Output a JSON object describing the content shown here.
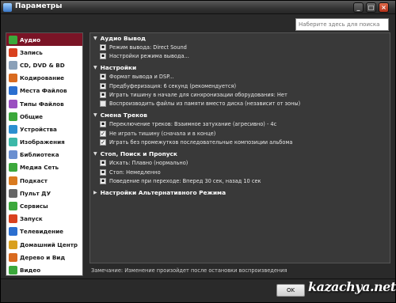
{
  "window": {
    "title": "Параметры"
  },
  "search": {
    "placeholder": "Наберите здесь для поиска"
  },
  "sidebar": {
    "items": [
      {
        "label": "Аудио",
        "icon": "speaker-icon",
        "color": "#3ba83b",
        "active": true
      },
      {
        "label": "Запись",
        "icon": "record-icon",
        "color": "#d9411f"
      },
      {
        "label": "CD, DVD & BD",
        "icon": "disc-icon",
        "color": "#8aa0b8"
      },
      {
        "label": "Кодирование",
        "icon": "encode-icon",
        "color": "#d96a1f"
      },
      {
        "label": "Места Файлов",
        "icon": "folder-icon",
        "color": "#2b6fd0"
      },
      {
        "label": "Типы Файлов",
        "icon": "filetype-icon",
        "color": "#9a4fc0"
      },
      {
        "label": "Общие",
        "icon": "general-icon",
        "color": "#3ba83b"
      },
      {
        "label": "Устройства",
        "icon": "device-icon",
        "color": "#2b8fd0"
      },
      {
        "label": "Изображения",
        "icon": "image-icon",
        "color": "#3bb8a8"
      },
      {
        "label": "Библиотека",
        "icon": "library-icon",
        "color": "#6a8fd0"
      },
      {
        "label": "Медиа Сеть",
        "icon": "network-icon",
        "color": "#3ba83b"
      },
      {
        "label": "Подкаст",
        "icon": "podcast-icon",
        "color": "#d97a1f"
      },
      {
        "label": "Пульт ДУ",
        "icon": "remote-icon",
        "color": "#666666"
      },
      {
        "label": "Сервисы",
        "icon": "services-icon",
        "color": "#3ba83b"
      },
      {
        "label": "Запуск",
        "icon": "startup-icon",
        "color": "#d9411f"
      },
      {
        "label": "Телевидение",
        "icon": "tv-icon",
        "color": "#2b6fd0"
      },
      {
        "label": "Домашний Центр",
        "icon": "home-icon",
        "color": "#d9a01f"
      },
      {
        "label": "Дерево и Вид",
        "icon": "tree-icon",
        "color": "#d96a1f"
      },
      {
        "label": "Видео",
        "icon": "video-icon",
        "color": "#3ba83b"
      }
    ]
  },
  "sections": {
    "audio_output": {
      "title": "Аудио Вывод",
      "rows": [
        {
          "label": "Режим вывода: Direct Sound",
          "type": "link"
        },
        {
          "label": "Настройки режима вывода...",
          "type": "link"
        }
      ]
    },
    "settings": {
      "title": "Настройки",
      "rows": [
        {
          "label": "Формат вывода и DSP...",
          "type": "link"
        },
        {
          "label": "Предбуферизация: 6 секунд (рекомендуется)",
          "type": "link"
        },
        {
          "label": "Играть тишину в начале для синхронизации оборудования: Нет",
          "type": "link"
        },
        {
          "label": "Воспроизводить файлы из памяти вместо диска (независит от зоны)",
          "type": "checkbox",
          "checked": false
        }
      ]
    },
    "track_change": {
      "title": "Смена Треков",
      "rows": [
        {
          "label": "Переключение треков: Взаимное затухание (агресивно) - 4с",
          "type": "link"
        },
        {
          "label": "Не играть тишину (сначала и в конце)",
          "type": "checkbox",
          "checked": true
        },
        {
          "label": "Играть без промежутков последовательные композиции альбома",
          "type": "checkbox",
          "checked": true
        }
      ]
    },
    "stop_seek": {
      "title": "Стоп, Поиск и Пропуск",
      "rows": [
        {
          "label": "Искать: Плавно (нормально)",
          "type": "link"
        },
        {
          "label": "Стоп: Немедленно",
          "type": "link"
        },
        {
          "label": "Поведение при переходе: Вперед 30 сек, назад 10 сек",
          "type": "link"
        }
      ]
    },
    "alt_mode": {
      "title": "Настройки Альтернативного Режима"
    }
  },
  "note": "Замечание: Изменение произойдет после остановки воспроизведения",
  "buttons": {
    "ok": "OK"
  },
  "watermark": "kazachya.net"
}
